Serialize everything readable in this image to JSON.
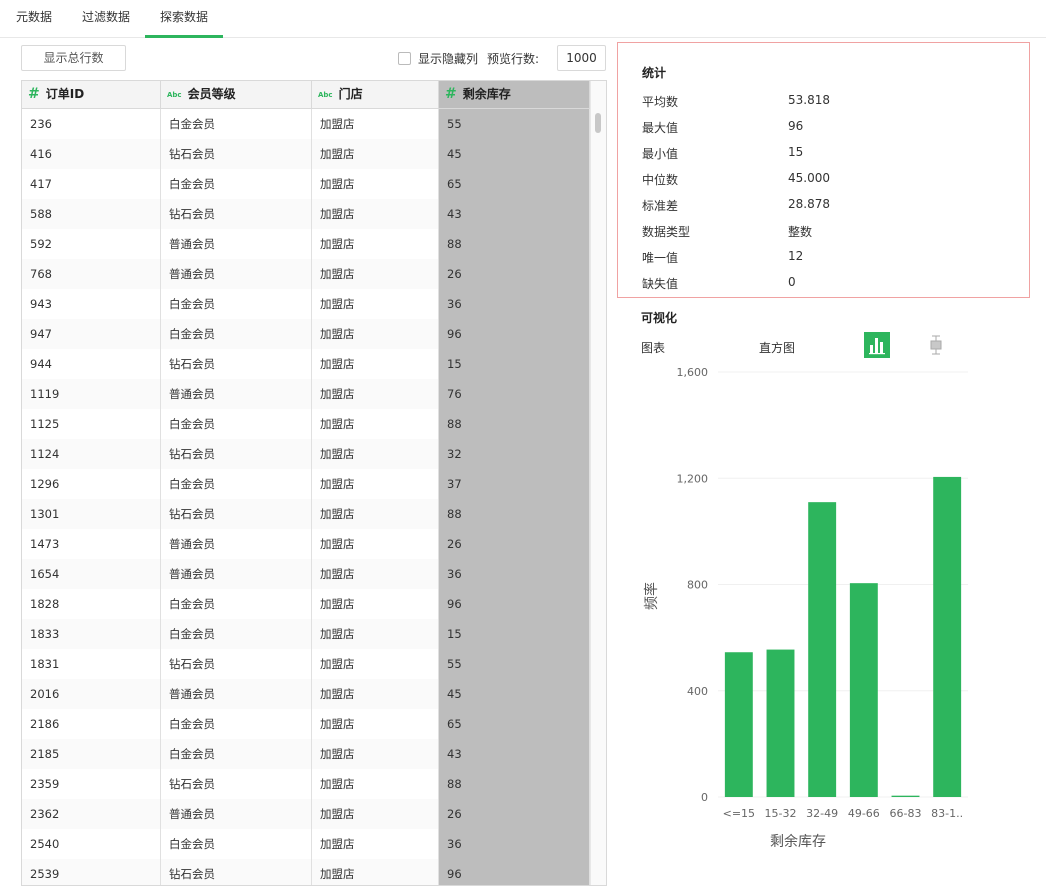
{
  "tabs": [
    "元数据",
    "过滤数据",
    "探索数据"
  ],
  "toolbar": {
    "show_total_label": "显示总行数",
    "show_hidden_label": "显示隐藏列",
    "preview_rows_label": "预览行数:",
    "preview_rows_value": "1000"
  },
  "table": {
    "columns": [
      {
        "label": "订单ID",
        "type_icon": "#"
      },
      {
        "label": "会员等级",
        "type_icon": "Abc"
      },
      {
        "label": "门店",
        "type_icon": "Abc"
      },
      {
        "label": "剩余库存",
        "type_icon": "#"
      }
    ],
    "rows": [
      [
        "236",
        "白金会员",
        "加盟店",
        "55"
      ],
      [
        "416",
        "钻石会员",
        "加盟店",
        "45"
      ],
      [
        "417",
        "白金会员",
        "加盟店",
        "65"
      ],
      [
        "588",
        "钻石会员",
        "加盟店",
        "43"
      ],
      [
        "592",
        "普通会员",
        "加盟店",
        "88"
      ],
      [
        "768",
        "普通会员",
        "加盟店",
        "26"
      ],
      [
        "943",
        "白金会员",
        "加盟店",
        "36"
      ],
      [
        "947",
        "白金会员",
        "加盟店",
        "96"
      ],
      [
        "944",
        "钻石会员",
        "加盟店",
        "15"
      ],
      [
        "1119",
        "普通会员",
        "加盟店",
        "76"
      ],
      [
        "1125",
        "白金会员",
        "加盟店",
        "88"
      ],
      [
        "1124",
        "钻石会员",
        "加盟店",
        "32"
      ],
      [
        "1296",
        "白金会员",
        "加盟店",
        "37"
      ],
      [
        "1301",
        "钻石会员",
        "加盟店",
        "88"
      ],
      [
        "1473",
        "普通会员",
        "加盟店",
        "26"
      ],
      [
        "1654",
        "普通会员",
        "加盟店",
        "36"
      ],
      [
        "1828",
        "白金会员",
        "加盟店",
        "96"
      ],
      [
        "1833",
        "白金会员",
        "加盟店",
        "15"
      ],
      [
        "1831",
        "钻石会员",
        "加盟店",
        "55"
      ],
      [
        "2016",
        "普通会员",
        "加盟店",
        "45"
      ],
      [
        "2186",
        "白金会员",
        "加盟店",
        "65"
      ],
      [
        "2185",
        "白金会员",
        "加盟店",
        "43"
      ],
      [
        "2359",
        "钻石会员",
        "加盟店",
        "88"
      ],
      [
        "2362",
        "普通会员",
        "加盟店",
        "26"
      ],
      [
        "2540",
        "白金会员",
        "加盟店",
        "36"
      ],
      [
        "2539",
        "钻石会员",
        "加盟店",
        "96"
      ]
    ]
  },
  "stats": {
    "title": "统计",
    "items": [
      {
        "key": "平均数",
        "value": "53.818"
      },
      {
        "key": "最大值",
        "value": "96"
      },
      {
        "key": "最小值",
        "value": "15"
      },
      {
        "key": "中位数",
        "value": "45.000"
      },
      {
        "key": "标准差",
        "value": "28.878"
      },
      {
        "key": "数据类型",
        "value": "整数"
      },
      {
        "key": "唯一值",
        "value": "12"
      },
      {
        "key": "缺失值",
        "value": "0"
      }
    ]
  },
  "visualization": {
    "title": "可视化",
    "chart_label": "图表",
    "chart_type": "直方图"
  },
  "colors": {
    "accent": "#2db55d",
    "selected_column": "#bdbdbd",
    "stats_border": "#f0a2a2"
  },
  "chart_data": {
    "type": "bar",
    "categories": [
      "<=15",
      "15-32",
      "32-49",
      "49-66",
      "66-83",
      "83-1.."
    ],
    "values": [
      545,
      555,
      1110,
      805,
      5,
      1205
    ],
    "xlabel": "剩余库存",
    "ylabel": "频率",
    "ylim": [
      0,
      1600
    ],
    "yticks": [
      "0",
      "400",
      "800",
      "1,200",
      "1,600"
    ],
    "grid": true
  }
}
